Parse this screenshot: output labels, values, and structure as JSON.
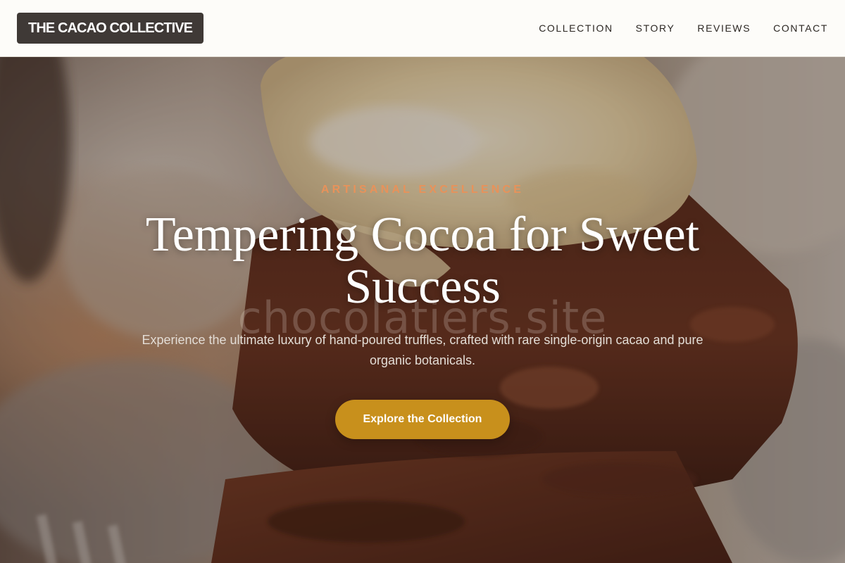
{
  "brand": {
    "name": "THE CACAO COLLECTIVE"
  },
  "nav": {
    "items": [
      {
        "label": "COLLECTION"
      },
      {
        "label": "STORY"
      },
      {
        "label": "REVIEWS"
      },
      {
        "label": "CONTACT"
      }
    ]
  },
  "hero": {
    "eyebrow": "ARTISANAL EXCELLENCE",
    "headline": "Tempering Cocoa for Sweet Success",
    "watermark": "chocolatiers.site",
    "subtext": "Experience the ultimate luxury of hand-poured truffles, crafted with rare single-origin cacao and pure organic botanicals.",
    "cta_label": "Explore the Collection"
  },
  "colors": {
    "accent": "#c8901c",
    "eyebrow": "#e8925a",
    "logo_bg": "#3f3936",
    "header_bg": "#fdfcf9"
  }
}
